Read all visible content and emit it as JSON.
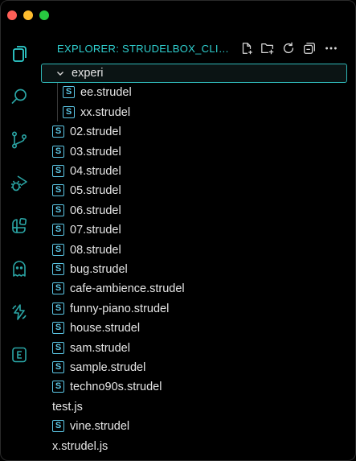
{
  "window": {
    "controls": [
      "close",
      "minimize",
      "maximize"
    ]
  },
  "activity_bar": {
    "icons": [
      "files-icon",
      "search-icon",
      "source-control-icon",
      "run-debug-icon",
      "extensions-icon",
      "ghost-icon",
      "lightning-icon",
      "custom-e-icon"
    ]
  },
  "explorer": {
    "title": "EXPLORER: STRUDELBOX_CLIENT...",
    "actions": [
      "new-file-icon",
      "new-folder-icon",
      "refresh-icon",
      "collapse-all-icon",
      "more-icon"
    ]
  },
  "tree": {
    "folder": {
      "name": "experi",
      "expanded": true
    },
    "children": [
      "ee.strudel",
      "xx.strudel"
    ],
    "files": [
      {
        "name": "02.strudel",
        "icon": "S"
      },
      {
        "name": "03.strudel",
        "icon": "S"
      },
      {
        "name": "04.strudel",
        "icon": "S"
      },
      {
        "name": "05.strudel",
        "icon": "S"
      },
      {
        "name": "06.strudel",
        "icon": "S"
      },
      {
        "name": "07.strudel",
        "icon": "S"
      },
      {
        "name": "08.strudel",
        "icon": "S"
      },
      {
        "name": "bug.strudel",
        "icon": "S"
      },
      {
        "name": "cafe-ambience.strudel",
        "icon": "S"
      },
      {
        "name": "funny-piano.strudel",
        "icon": "S"
      },
      {
        "name": "house.strudel",
        "icon": "S"
      },
      {
        "name": "sam.strudel",
        "icon": "S"
      },
      {
        "name": "sample.strudel",
        "icon": "S"
      },
      {
        "name": "techno90s.strudel",
        "icon": "S"
      },
      {
        "name": "test.js",
        "icon": ""
      },
      {
        "name": "vine.strudel",
        "icon": "S"
      },
      {
        "name": "x.strudel.js",
        "icon": ""
      }
    ]
  },
  "colors": {
    "accent": "#2fd0d0",
    "file_icon": "#5cc7e6",
    "text": "#e6e6e6",
    "background": "#000000"
  }
}
